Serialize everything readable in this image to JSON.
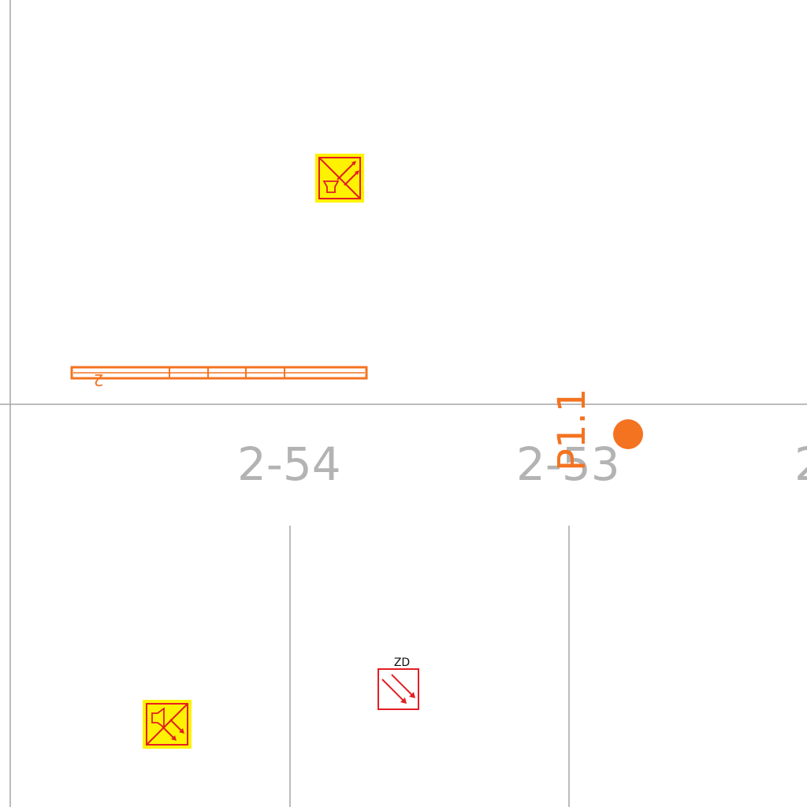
{
  "colors": {
    "wall": "#a6a6a6",
    "room_label": "#b3b3b3",
    "orange": "#f47321",
    "red": "#e31e24",
    "yellow": "#fff200"
  },
  "rooms": [
    {
      "label": "2-54"
    },
    {
      "label": "2-53"
    },
    {
      "label": "2"
    }
  ],
  "tag": {
    "label": "P1.1"
  },
  "rack": {
    "label": "2"
  },
  "symbols": {
    "smoke_control_top": {
      "icon": "smoke-extraction-icon"
    },
    "smoke_control_bottom": {
      "icon": "smoke-damper-speaker-icon"
    },
    "zone_damper": {
      "icon": "zone-damper-icon",
      "label": "ZD"
    }
  }
}
